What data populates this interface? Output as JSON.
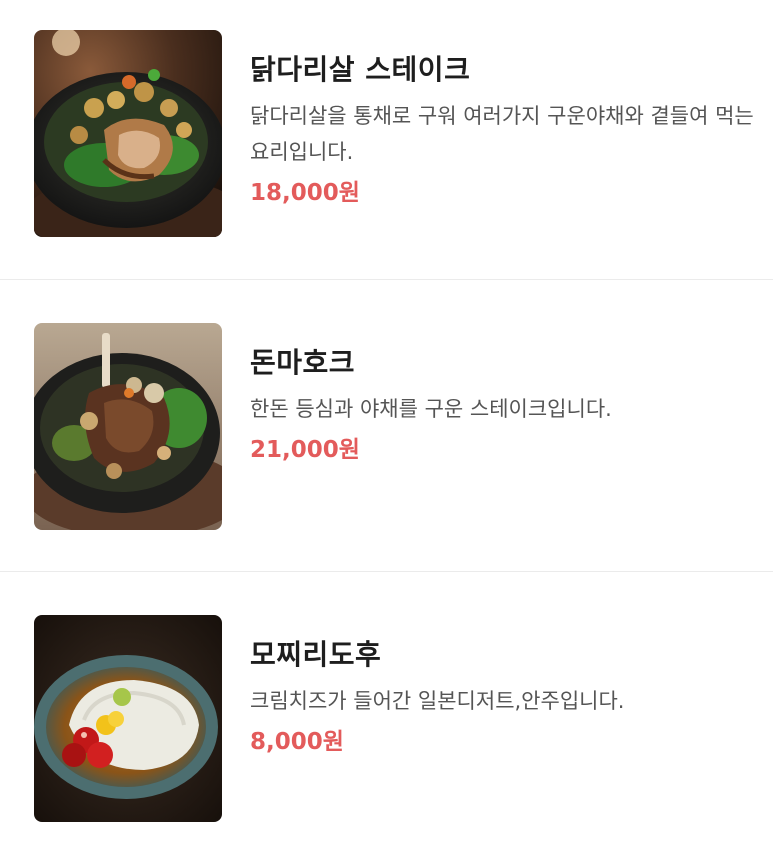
{
  "menu": {
    "items": [
      {
        "name": "닭다리살 스테이크",
        "description": "닭다리살을 통채로 구워 여러가지 구운야채와 곁들여 먹는 요리입니다.",
        "price": "18,000원",
        "image_icon": "chicken-steak-photo"
      },
      {
        "name": "돈마호크",
        "description": "한돈 등심과 야채를 구운 스테이크입니다.",
        "price": "21,000원",
        "image_icon": "pork-tomahawk-photo"
      },
      {
        "name": "모찌리도후",
        "description": "크림치즈가 들어간 일본디저트,안주입니다.",
        "price": "8,000원",
        "image_icon": "mochi-tofu-photo"
      }
    ]
  },
  "colors": {
    "price": "#e35b5b",
    "title": "#1e1e1e",
    "description": "#555555",
    "divider": "#ebebeb"
  }
}
